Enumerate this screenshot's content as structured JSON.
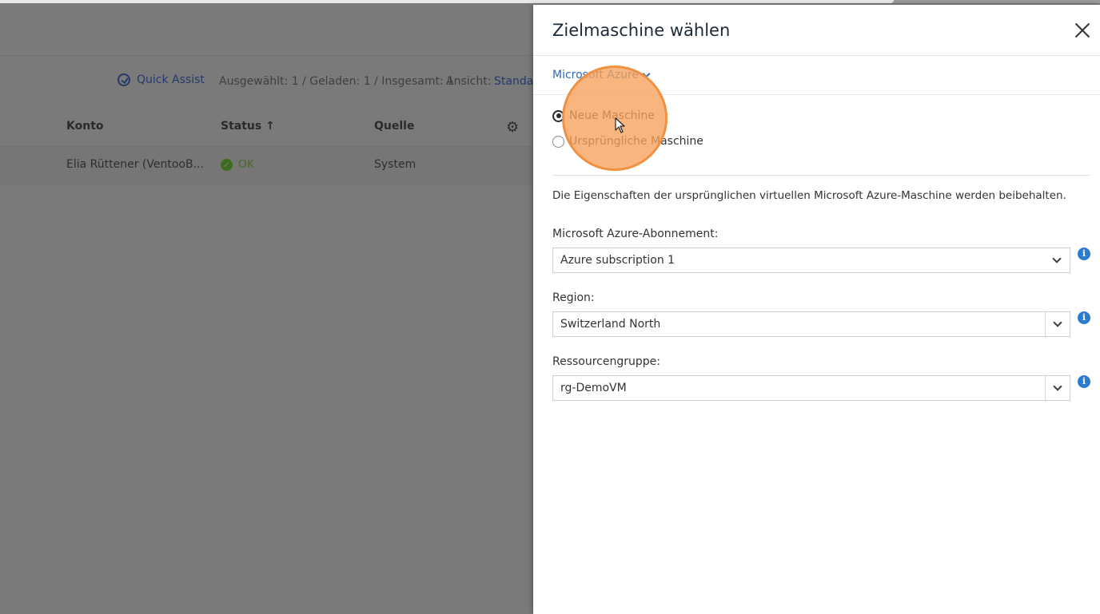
{
  "background": {
    "toolbar": {
      "quick_assist": "Quick Assist",
      "counts": "Ausgewählt: 1 / Geladen: 1 / Insgesamt: 1",
      "view_label": "Ansicht:",
      "view_value": "Standard"
    },
    "table": {
      "headers": {
        "account": "Konto",
        "status": "Status ↑",
        "source": "Quelle"
      },
      "rows": [
        {
          "account": "Elia Rüttener (VentooB...",
          "status": "OK",
          "source": "System"
        }
      ]
    }
  },
  "panel": {
    "title": "Zielmaschine wählen",
    "provider": "Microsoft Azure",
    "radio_options": [
      {
        "label": "Neue Maschine",
        "selected": true
      },
      {
        "label": "Ursprüngliche Maschine",
        "selected": false
      }
    ],
    "description": "Die Eigenschaften der ursprünglichen virtuellen Microsoft Azure-Maschine werden beibehalten.",
    "fields": {
      "subscription": {
        "label": "Microsoft Azure-Abonnement:",
        "value": "Azure subscription 1"
      },
      "region": {
        "label": "Region:",
        "value": "Switzerland North"
      },
      "resource_group": {
        "label": "Ressourcengruppe:",
        "value": "rg-DemoVM"
      }
    }
  },
  "icons": [
    "close-icon",
    "chevron-down-icon",
    "info-icon",
    "gear-icon",
    "quick-assist-icon",
    "check-icon",
    "cursor-icon"
  ],
  "colors": {
    "accent": "#2d6bb4",
    "info": "#2b7bd1",
    "click_highlight": "#f7a05a",
    "overlay": "#7a7a7a"
  }
}
